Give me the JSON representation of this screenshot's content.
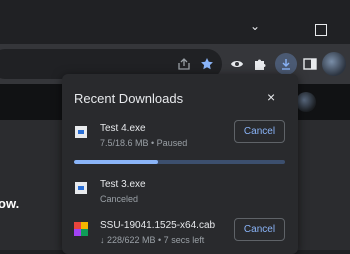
{
  "window": {
    "chevron_glyph": "⌄"
  },
  "toolbar": {
    "icons": [
      "share-icon",
      "star-icon",
      "eye-icon",
      "puzzle-icon",
      "download-icon",
      "side-panel-icon"
    ]
  },
  "page": {
    "partial_text": "ow."
  },
  "downloads_panel": {
    "title": "Recent Downloads",
    "close_glyph": "×",
    "items": [
      {
        "name": "Test 4.exe",
        "status": "7.5/18.6 MB • Paused",
        "action": "Cancel",
        "progress": 0.4
      },
      {
        "name": "Test 3.exe",
        "status": "Canceled"
      },
      {
        "name": "SSU-19041.1525-x64.cab",
        "status": "↓ 228/622 MB • 7 secs left",
        "action": "Cancel"
      }
    ]
  },
  "colors": {
    "accent": "#8ab4f8",
    "panel_bg": "#292a2d",
    "toolbar_bg": "#35363a"
  }
}
